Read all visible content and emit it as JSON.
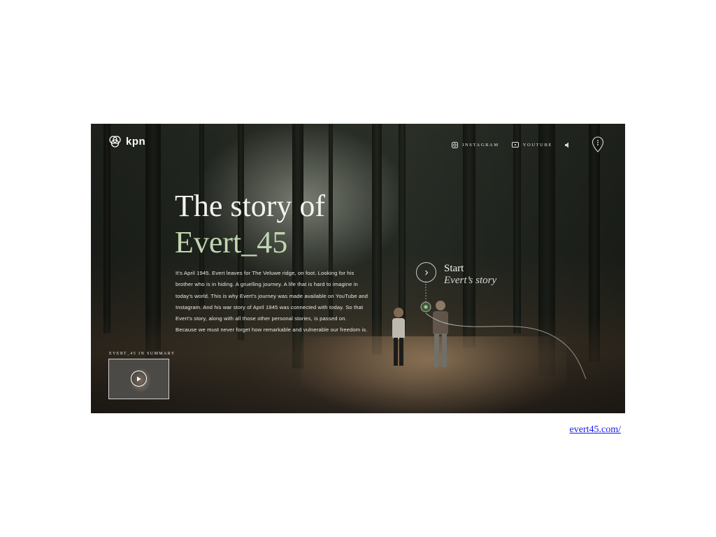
{
  "brand": {
    "logo_text": "kpn"
  },
  "nav": {
    "instagram_label": "INSTAGRAM",
    "youtube_label": "YOUTUBE"
  },
  "hero": {
    "title_line1": "The story of",
    "title_line2": "Evert_45",
    "intro_lines": [
      "It's April 1945. Evert leaves for The Veluwe ridge, on foot. Looking for his",
      "brother who is in hiding. A gruelling journey. A life that is hard to imagine in",
      "today's world. This is why Evert's journey was made available on YouTube and",
      "Instagram. And his war story of April 1945 was connected with today. So that",
      "Evert's story, along with all those other personal stories, is passed on.",
      "Because we must never forget how remarkable and vulnerable our freedom is."
    ]
  },
  "start": {
    "line1": "Start",
    "line2": "Evert’s story"
  },
  "summary": {
    "label": "EVERT_45 IN SUMMARY"
  },
  "source_link": "evert45.com/",
  "colors": {
    "accent_green": "#bfd6b0",
    "link_blue": "#1a1aee",
    "forest_dark": "#262b24"
  },
  "icons": [
    "kpn-logo-icon",
    "instagram-icon",
    "youtube-icon",
    "speaker-icon",
    "map-pin-icon",
    "chevron-right-icon",
    "play-icon"
  ]
}
